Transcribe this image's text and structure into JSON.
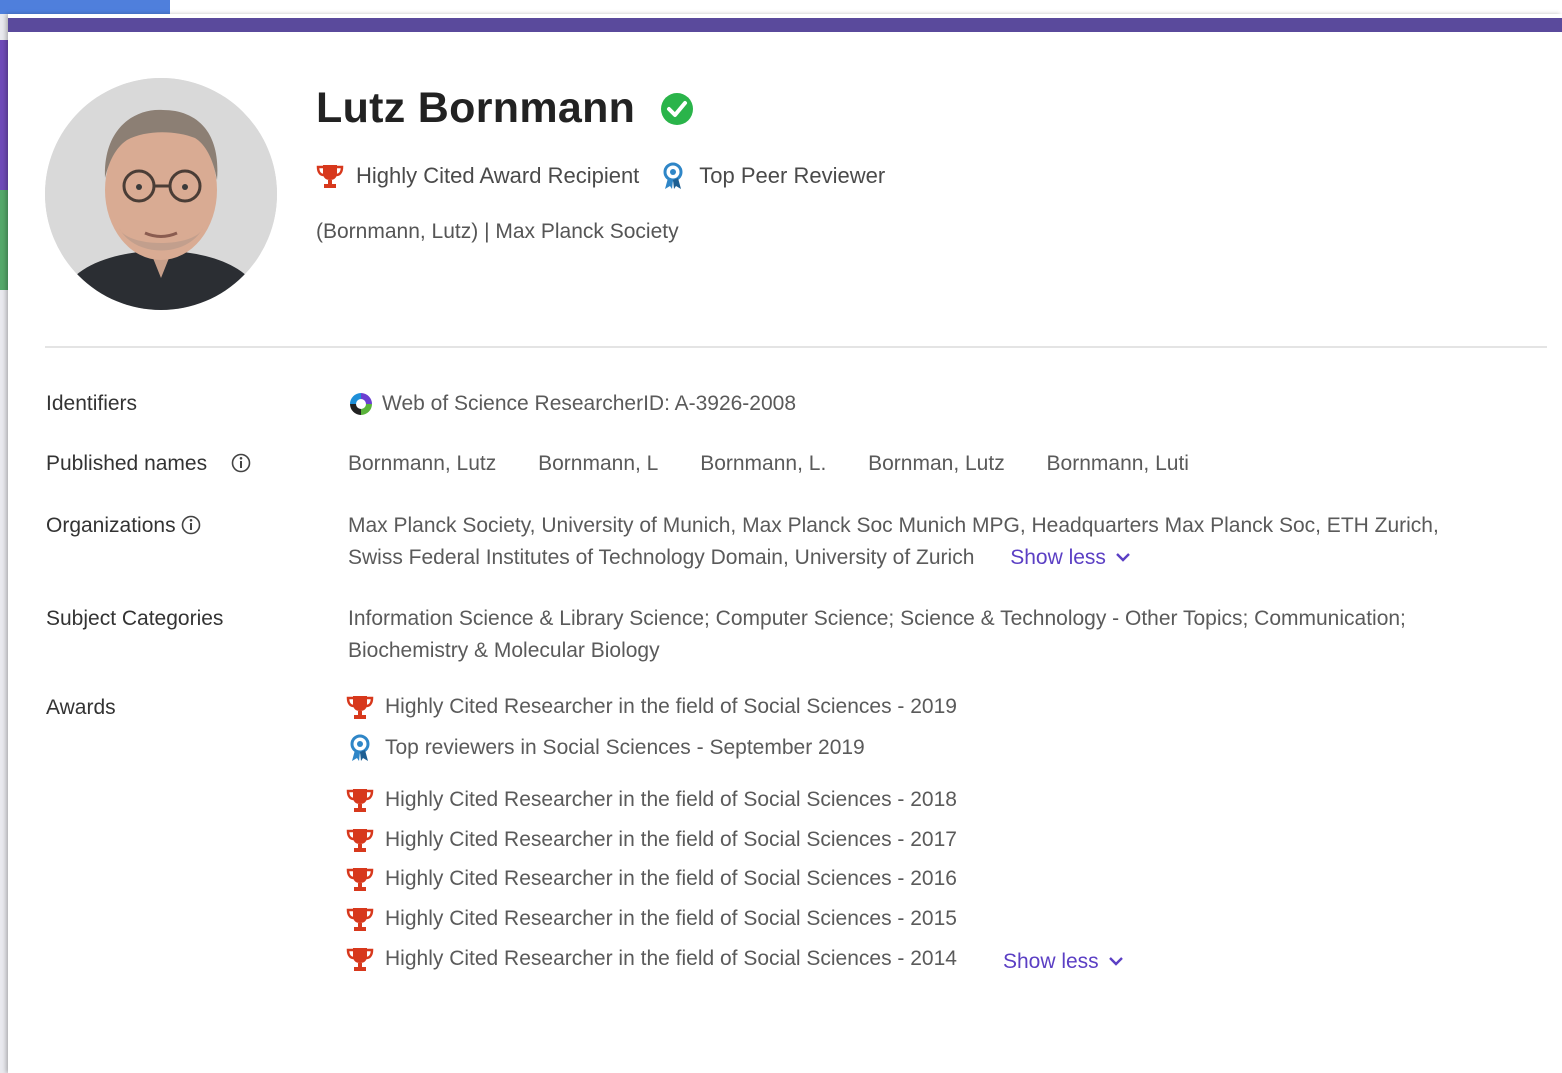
{
  "colors": {
    "accent": "#5b3fc4",
    "trophy": "#d7381c",
    "ribbon": "#2f86c7",
    "verified": "#2ab44a",
    "topbar": "#5a4a9c"
  },
  "profile": {
    "name": "Lutz Bornmann",
    "badges": [
      {
        "icon": "trophy-icon",
        "label": "Highly Cited Award Recipient"
      },
      {
        "icon": "ribbon-icon",
        "label": "Top Peer Reviewer"
      }
    ],
    "affiliation": "(Bornmann, Lutz) | Max Planck Society"
  },
  "details": {
    "identifiers": {
      "label": "Identifiers",
      "value": "Web of Science ResearcherID: A-3926-2008"
    },
    "published_names": {
      "label": "Published names",
      "names": [
        "Bornmann, Lutz",
        "Bornmann, L",
        "Bornmann, L.",
        "Bornman, Lutz",
        "Bornmann, Luti"
      ]
    },
    "organizations": {
      "label": "Organizations",
      "line1": "Max Planck Society,  University of Munich,  Max Planck Soc Munich MPG,  Headquarters Max Planck Soc,  ETH Zurich,",
      "line2": "Swiss Federal Institutes of Technology Domain,  University of Zurich",
      "toggle": "Show less"
    },
    "subjects": {
      "label": "Subject Categories",
      "line1": "Information Science & Library Science;  Computer Science;  Science & Technology - Other Topics;  Communication;",
      "line2": "Biochemistry & Molecular Biology"
    },
    "awards": {
      "label": "Awards",
      "items": [
        {
          "icon": "trophy-icon",
          "text": "Highly Cited Researcher in the field of Social Sciences - 2019"
        },
        {
          "icon": "ribbon-icon",
          "text": "Top reviewers in Social Sciences - September 2019"
        },
        {
          "icon": "trophy-icon",
          "text": "Highly Cited Researcher in the field of Social Sciences - 2018"
        },
        {
          "icon": "trophy-icon",
          "text": "Highly Cited Researcher in the field of Social Sciences - 2017"
        },
        {
          "icon": "trophy-icon",
          "text": "Highly Cited Researcher in the field of Social Sciences - 2016"
        },
        {
          "icon": "trophy-icon",
          "text": "Highly Cited Researcher in the field of Social Sciences - 2015"
        },
        {
          "icon": "trophy-icon",
          "text": "Highly Cited Researcher in the field of Social Sciences - 2014"
        }
      ],
      "toggle": "Show less"
    }
  }
}
